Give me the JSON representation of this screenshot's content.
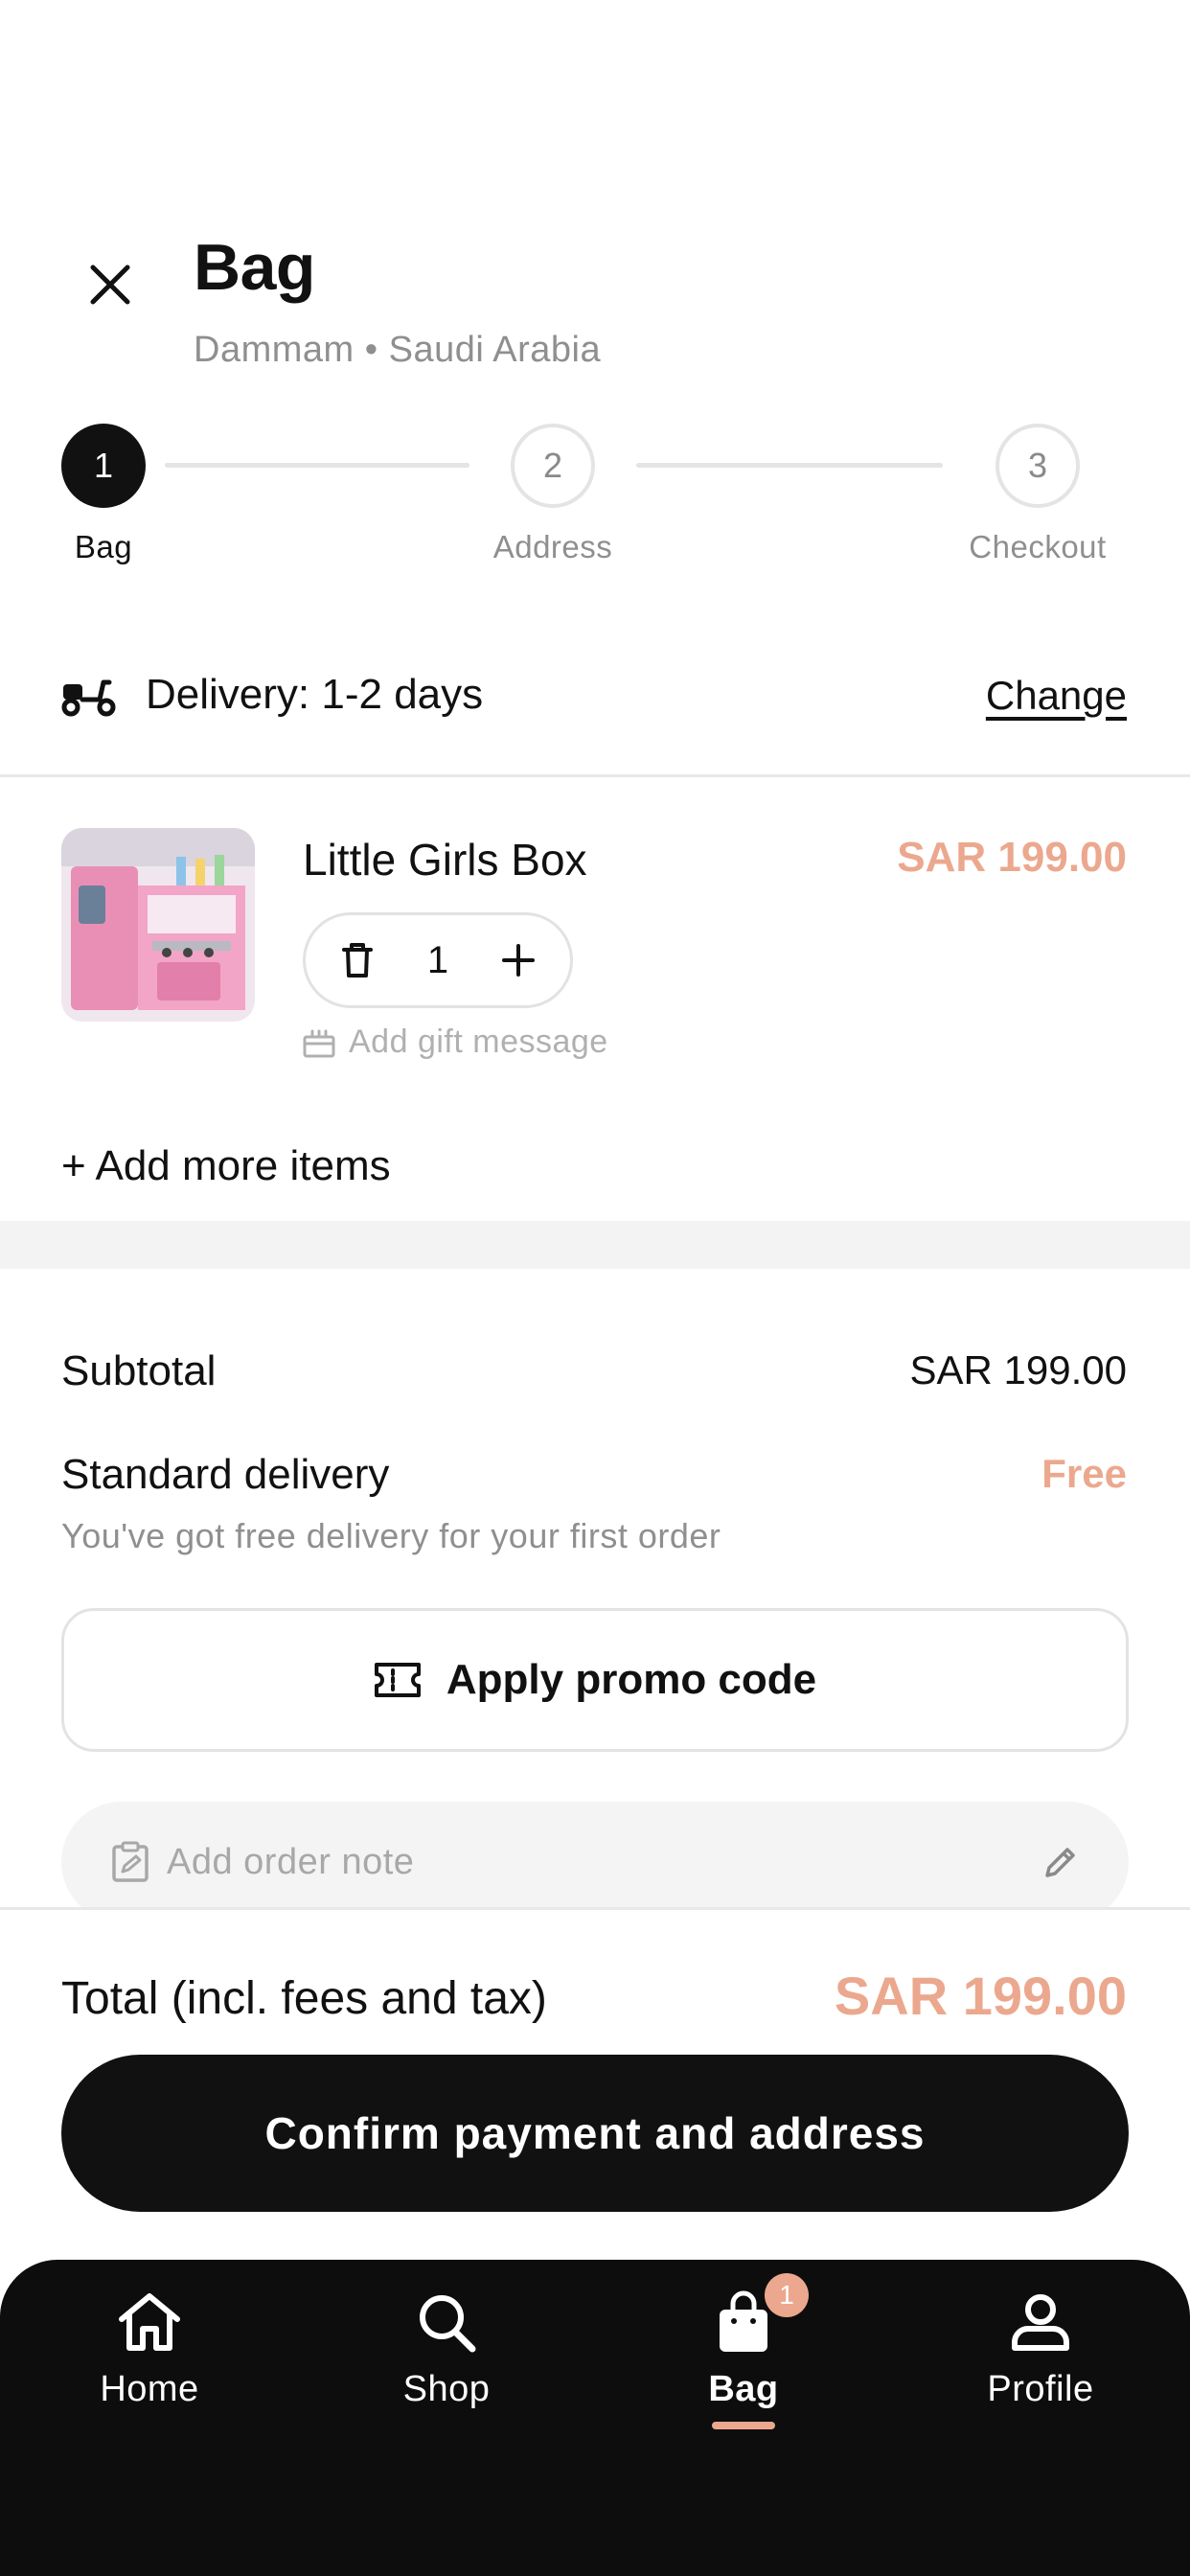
{
  "header": {
    "title": "Bag",
    "location": "Dammam • Saudi Arabia"
  },
  "stepper": {
    "steps": [
      {
        "number": "1",
        "label": "Bag",
        "active": true
      },
      {
        "number": "2",
        "label": "Address",
        "active": false
      },
      {
        "number": "3",
        "label": "Checkout",
        "active": false
      }
    ]
  },
  "delivery": {
    "text": "Delivery: 1-2 days",
    "change_label": "Change"
  },
  "cart": {
    "items": [
      {
        "name": "Little Girls Box",
        "price": "SAR 199.00",
        "quantity": "1",
        "gift_label": "Add gift message"
      }
    ],
    "add_more_label": "+ Add more items"
  },
  "summary": {
    "subtotal_label": "Subtotal",
    "subtotal_value": "SAR 199.00",
    "delivery_label": "Standard delivery",
    "delivery_value": "Free",
    "delivery_note": "You've got free delivery for your first order",
    "promo_label": "Apply promo code",
    "order_note_placeholder": "Add order note",
    "total_label": "Total (incl. fees and tax)",
    "total_value": "SAR 199.00",
    "confirm_label": "Confirm payment and address"
  },
  "nav": {
    "items": [
      {
        "label": "Home",
        "icon": "home-icon"
      },
      {
        "label": "Shop",
        "icon": "search-icon"
      },
      {
        "label": "Bag",
        "icon": "bag-icon",
        "active": true,
        "badge": "1"
      },
      {
        "label": "Profile",
        "icon": "profile-icon"
      }
    ]
  },
  "colors": {
    "accent": "#eba88e",
    "dark": "#111111",
    "muted": "#8f8f8f"
  }
}
